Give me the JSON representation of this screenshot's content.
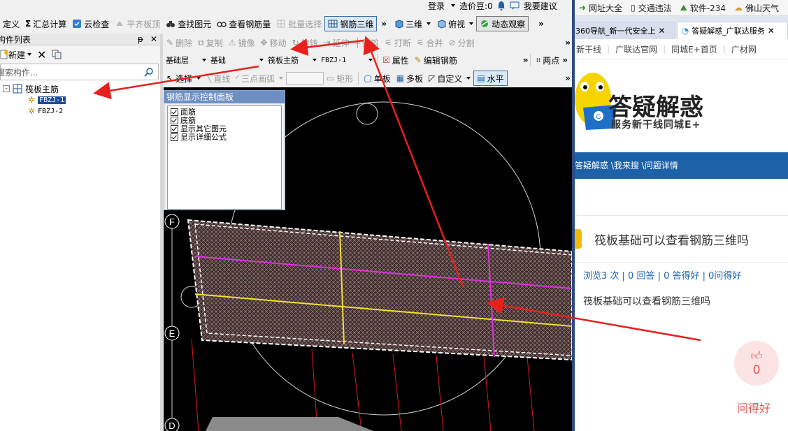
{
  "top_right_bar": {
    "login": "登录",
    "price": "造价豆:0",
    "feedback": "我要建议"
  },
  "toolbar1": {
    "define": "定义",
    "sum_calc": "汇总计算",
    "cloud_check": "云检查",
    "flat_board": "平齐板顶",
    "find_elem": "查找图元",
    "view_rebar": "查看钢筋量",
    "batch_select": "批量选择",
    "rebar_3d": "钢筋三维",
    "view_3d": "三维",
    "top_view": "俯视",
    "dyn_observe": "动态观察"
  },
  "component_list": {
    "title": "构件列表",
    "new_button": "新建",
    "search_placeholder": "搜索构件...",
    "tree_root": "筏板主筋",
    "items": [
      "FBZJ-1",
      "FBZJ-2"
    ]
  },
  "toolbar2": {
    "delete": "删除",
    "copy": "复制",
    "mirror": "镜像",
    "move": "移动",
    "rotate": "旋转",
    "extend": "延伸",
    "trim": "修剪",
    "break": "打断",
    "merge": "合并",
    "split": "分割"
  },
  "toolbar3": {
    "floor": "基础层",
    "category": "基础",
    "type": "筏板主筋",
    "element": "FBZJ-1",
    "property": "属性",
    "edit_rebar": "编辑钢筋",
    "two_point": "两点"
  },
  "toolbar4": {
    "select": "选择",
    "line": "直线",
    "arc": "三点画弧",
    "rect": "矩形",
    "single_board": "单板",
    "multi_board": "多板",
    "custom": "自定义",
    "horizontal": "水平"
  },
  "rebar_panel": {
    "title": "钢筋显示控制面板",
    "options": [
      "面筋",
      "底筋",
      "显示其它图元",
      "显示详细公式"
    ]
  },
  "axis_labels": [
    "F",
    "E",
    "D"
  ],
  "browser": {
    "bookmarks": [
      "网址大全",
      "交通违法",
      "软件-234",
      "佛山天气"
    ],
    "tabs": [
      "360导航_新一代安全上",
      "答疑解惑_广联达服务"
    ],
    "nav_links": [
      "新干线",
      "广联达官网",
      "同城E+首页",
      "广材网"
    ],
    "brand_title": "答疑解惑",
    "brand_sub": "服务新干线同城E+",
    "breadcrumb": "答疑解惑 \\我来搜 \\问题详情",
    "question_title": "筏板基础可以查看钢筋三维吗",
    "stats": "浏览3 次 | 0 回答 | 0 答得好 | 0问得好",
    "question_body": "筏板基础可以查看钢筋三维吗",
    "like_count": "0",
    "like_label": "问得好"
  },
  "colors": {
    "arrow": "#e8201c",
    "accent": "#1d62a8",
    "mesh": "#b89090"
  }
}
